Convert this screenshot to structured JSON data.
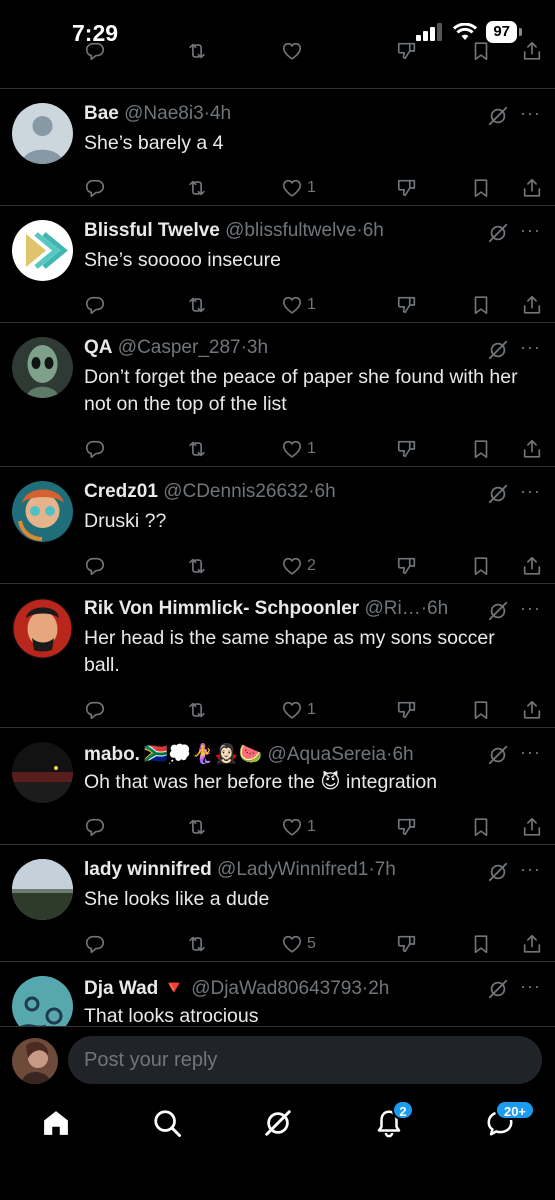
{
  "status_bar": {
    "time": "7:29",
    "battery": "97"
  },
  "tweets": [
    {
      "name": "Bae",
      "handle": "@Nae8i3",
      "time": "4h",
      "text": "She’s barely a 4",
      "likes": "1",
      "replies": "",
      "reposts": ""
    },
    {
      "name": "Blissful Twelve",
      "handle": "@blissfultwelve",
      "time": "6h",
      "text": "She’s sooooo insecure",
      "likes": "1",
      "replies": "",
      "reposts": ""
    },
    {
      "name": "QA",
      "handle": "@Casper_287",
      "time": "3h",
      "text": "Don’t forget the peace of paper she found with her not on the top of the list",
      "likes": "1",
      "replies": "",
      "reposts": ""
    },
    {
      "name": "Credz01",
      "handle": "@CDennis26632",
      "time": "6h",
      "text": "Druski ??",
      "likes": "2",
      "replies": "",
      "reposts": ""
    },
    {
      "name": "Rik Von Himmlick- Schpoonler",
      "handle": "@Ri…",
      "time": "6h",
      "text": "Her head is the same shape as my sons soccer ball.",
      "likes": "1",
      "replies": "",
      "reposts": ""
    },
    {
      "name": "mabo.",
      "flair": "🇿🇦💭🧜‍♀️🧛🏻‍♀️🍉",
      "handle": "@AquaSereia",
      "time": "6h",
      "text": "Oh that was her before the 😈 integration",
      "likes": "1",
      "replies": "",
      "reposts": ""
    },
    {
      "name": "lady winnifred",
      "handle": "@LadyWinnifred1",
      "time": "7h",
      "text": "She looks like a dude",
      "likes": "5",
      "replies": "",
      "reposts": ""
    },
    {
      "name": "Dja Wad",
      "flair": "🔻",
      "handle": "@DjaWad80643793",
      "time": "2h",
      "text": "That looks atrocious",
      "likes": "",
      "replies": "",
      "reposts": ""
    }
  ],
  "reply_bar": {
    "placeholder": "Post your reply"
  },
  "nav": {
    "notifications_badge": "2",
    "messages_badge": "20+"
  },
  "icons": {
    "reply": "reply-icon",
    "repost": "repost-icon",
    "like": "heart-icon",
    "downvote": "downvote-icon",
    "bookmark": "bookmark-icon",
    "share": "share-icon",
    "grok": "grok-icon",
    "more": "more-icon"
  },
  "colors": {
    "background": "#000000",
    "text": "#e7e9ea",
    "muted": "#71767b",
    "divider": "#2f3336",
    "accent": "#1d9bf0"
  }
}
